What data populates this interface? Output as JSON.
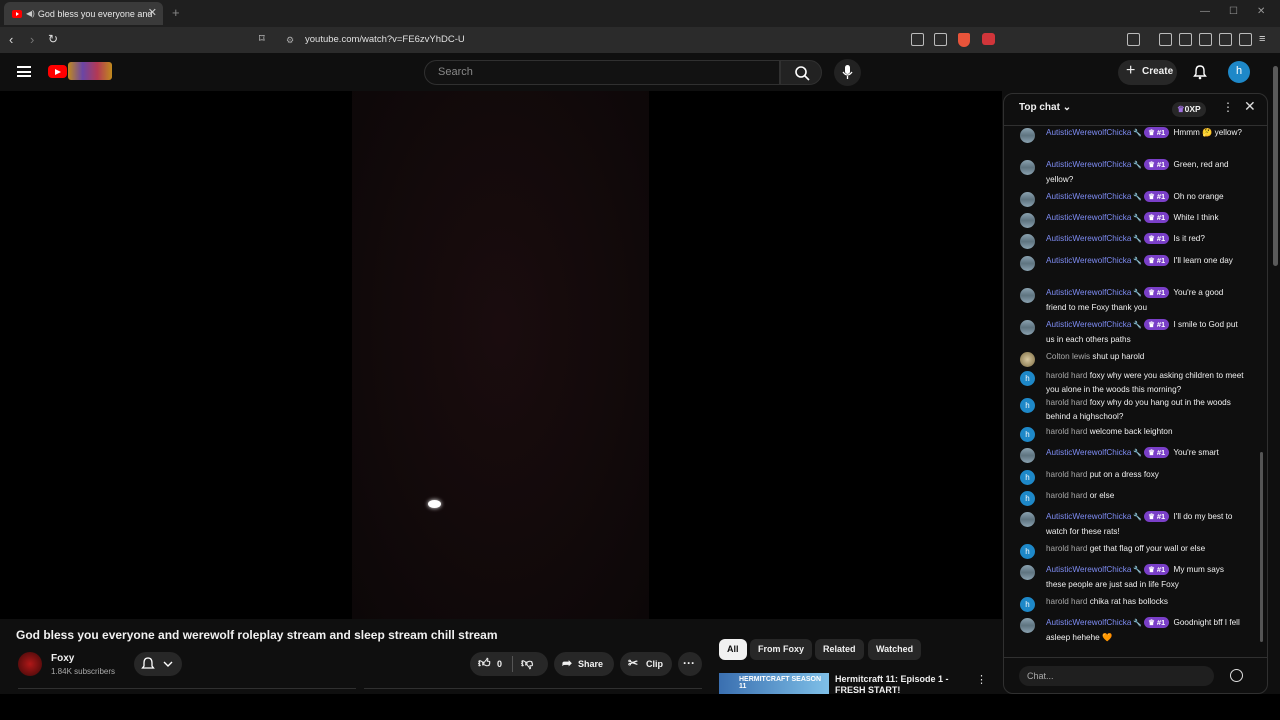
{
  "browser": {
    "tab_title": "God bless you everyone and",
    "url": "youtube.com/watch?v=FE6zvYhDC-U"
  },
  "header": {
    "search_placeholder": "Search",
    "create_label": "Create",
    "avatar_letter": "h"
  },
  "video": {
    "title": "God bless you everyone and werewolf roleplay stream and sleep stream chill stream",
    "channel": "Foxy",
    "subscribers": "1.84K subscribers",
    "likes": "0",
    "share_label": "Share",
    "clip_label": "Clip"
  },
  "related": {
    "chips": [
      "All",
      "From Foxy",
      "Related",
      "Watched"
    ],
    "items": [
      {
        "thumb_text": "HERMITCRAFT SEASON 11",
        "title": "Hermitcraft 11: Episode 1 - FRESH START!"
      }
    ]
  },
  "chat": {
    "mode": "Top chat",
    "xp": "0XP",
    "input_placeholder": "Chat...",
    "rank_label": "#1",
    "messages": [
      {
        "name": "AutisticWerewolfChicka",
        "member": true,
        "text": "Hmmm 🤔 yellow?"
      },
      {
        "name": "AutisticWerewolfChicka",
        "member": true,
        "text": "Green, red and yellow?"
      },
      {
        "name": "AutisticWerewolfChicka",
        "member": true,
        "text": "Oh no orange"
      },
      {
        "name": "AutisticWerewolfChicka",
        "member": true,
        "text": "White I think"
      },
      {
        "name": "AutisticWerewolfChicka",
        "member": true,
        "text": "Is it red?"
      },
      {
        "name": "AutisticWerewolfChicka",
        "member": true,
        "text": "I'll learn one day"
      },
      {
        "name": "AutisticWerewolfChicka",
        "member": true,
        "text": "You're a good friend to me Foxy thank you"
      },
      {
        "name": "AutisticWerewolfChicka",
        "member": true,
        "text": "I smile to God put us in each others paths"
      },
      {
        "name": "Colton lewis",
        "member": false,
        "text": "shut up harold"
      },
      {
        "name": "harold hard",
        "member": false,
        "text": "foxy why were you asking children to meet you alone in the woods this morning?"
      },
      {
        "name": "harold hard",
        "member": false,
        "text": "foxy why do you hang out in the woods behind a highschool?"
      },
      {
        "name": "harold hard",
        "member": false,
        "text": "welcome back leighton"
      },
      {
        "name": "AutisticWerewolfChicka",
        "member": true,
        "text": "You're smart"
      },
      {
        "name": "harold hard",
        "member": false,
        "text": "put on a dress foxy"
      },
      {
        "name": "harold hard",
        "member": false,
        "text": "or else"
      },
      {
        "name": "AutisticWerewolfChicka",
        "member": true,
        "text": "I'll do my best to watch for these rats!"
      },
      {
        "name": "harold hard",
        "member": false,
        "text": "get that flag off your wall or else"
      },
      {
        "name": "AutisticWerewolfChicka",
        "member": true,
        "text": "My mum says these people are just sad in life Foxy"
      },
      {
        "name": "harold hard",
        "member": false,
        "text": "chika rat has bollocks"
      },
      {
        "name": "AutisticWerewolfChicka",
        "member": true,
        "text": "Goodnight bff I fell asleep hehehe 🧡"
      }
    ]
  }
}
